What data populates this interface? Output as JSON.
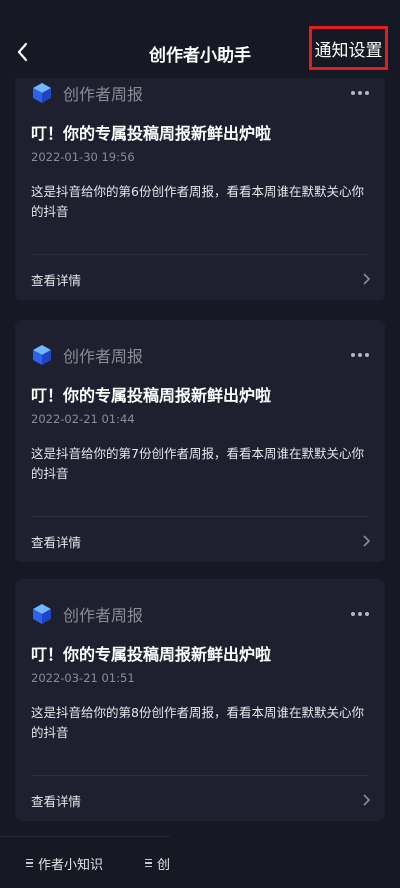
{
  "header": {
    "title": "创作者小助手",
    "settings_label": "通知设置"
  },
  "cards": [
    {
      "sender": "创作者周报",
      "title": "叮！你的专属投稿周报新鲜出炉啦",
      "time": "2022-01-30 19:56",
      "body": "这是抖音给你的第6份创作者周报，看看本周谁在默默关心你的抖音",
      "details_label": "查看详情"
    },
    {
      "sender": "创作者周报",
      "title": "叮！你的专属投稿周报新鲜出炉啦",
      "time": "2022-02-21 01:44",
      "body": "这是抖音给你的第7份创作者周报，看看本周谁在默默关心你的抖音",
      "details_label": "查看详情"
    },
    {
      "sender": "创作者周报",
      "title": "叮！你的专属投稿周报新鲜出炉啦",
      "time": "2022-03-21 01:51",
      "body": "这是抖音给你的第8份创作者周报，看看本周谁在默默关心你的抖音",
      "details_label": "查看详情"
    }
  ],
  "bottom_bar": {
    "item1": "作者小知识",
    "item2": "创"
  },
  "colors": {
    "background": "#161823",
    "card": "#1e2030",
    "highlight_border": "#e02020"
  },
  "icons": [
    "back-arrow-icon",
    "cube-avatar-icon",
    "more-dots-icon",
    "chevron-right-icon",
    "menu-list-icon"
  ]
}
